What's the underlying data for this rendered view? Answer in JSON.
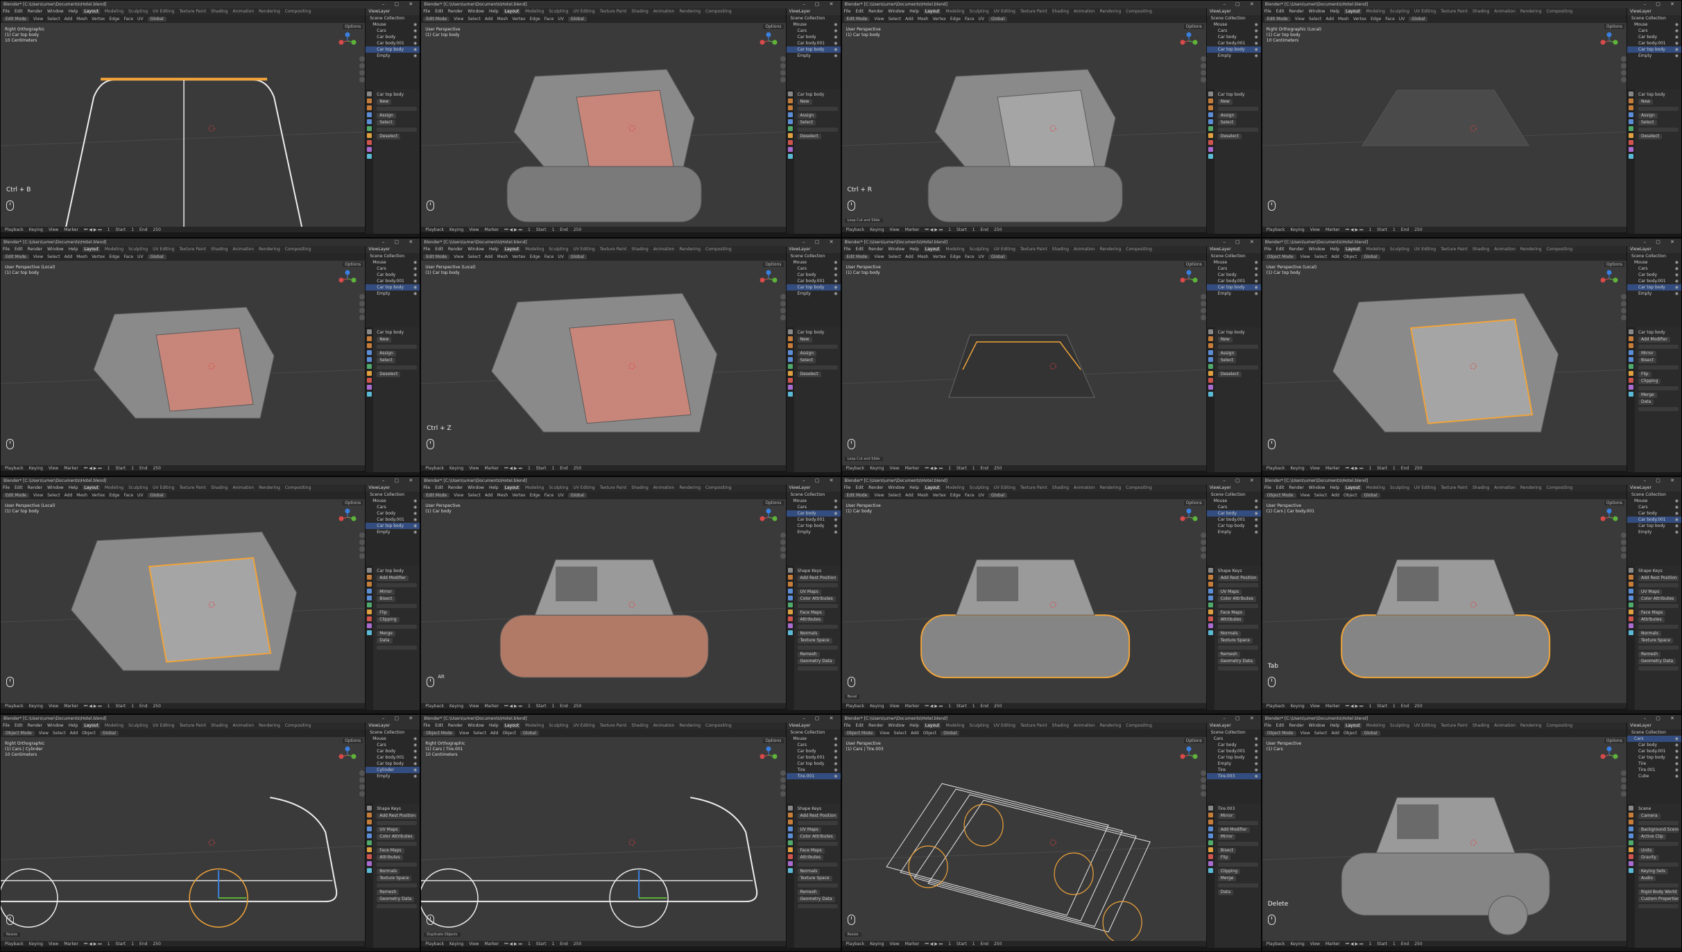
{
  "app": {
    "title": "Blender* [C:\\Users\\umer\\Documents\\Hotel.blend]",
    "menus": [
      "File",
      "Edit",
      "Render",
      "Window",
      "Help"
    ],
    "workspaces": [
      "Layout",
      "Modeling",
      "Sculpting",
      "UV Editing",
      "Texture Paint",
      "Shading",
      "Animation",
      "Rendering",
      "Compositing"
    ],
    "active_workspace": "Layout",
    "scene": "Scene",
    "view_layer": "ViewLayer",
    "header_menus": [
      "View",
      "Select",
      "Add",
      "Mesh",
      "Vertex",
      "Edge",
      "Face",
      "UV"
    ],
    "object_menus": [
      "View",
      "Select",
      "Add",
      "Object"
    ],
    "transform": "Global",
    "options": "Options",
    "timeline": [
      "Playback",
      "Keying",
      "View",
      "Marker"
    ],
    "frame": "1",
    "start_label": "Start",
    "start": "1",
    "end_label": "End",
    "end": "250",
    "outliner_title": "Scene Collection",
    "modifier_tab": "Car top body"
  },
  "colors": {
    "viewport_bg": "#3a3a3a",
    "selection": "#f0a43a",
    "active_row": "#334d80",
    "face_select": "#c8867a"
  },
  "tiles": [
    {
      "mode": "Edit Mode",
      "info": "Right Orthographic\n(1) Car top body\n10 Centimeters",
      "shortcut": "Ctrl + B",
      "outliner": [
        "Mouse",
        "Cars",
        "Car body",
        "Car body.001",
        "Car top body",
        "Empty"
      ],
      "selected": 4,
      "props": [
        "Car top body",
        "New",
        "Assign",
        "Select",
        "Deselect"
      ]
    },
    {
      "mode": "Edit Mode",
      "info": "User Perspective\n(1) Car top body",
      "shortcut": "",
      "outliner": [
        "Mouse",
        "Cars",
        "Car body",
        "Car body.001",
        "Car top body",
        "Empty"
      ],
      "selected": 4,
      "props": [
        "Car top body",
        "New",
        "Assign",
        "Select",
        "Deselect"
      ]
    },
    {
      "mode": "Edit Mode",
      "info": "User Perspective\n(1) Car top body",
      "shortcut": "Ctrl + R",
      "outliner": [
        "Mouse",
        "Cars",
        "Car body",
        "Car body.001",
        "Car top body",
        "Empty"
      ],
      "selected": 4,
      "props": [
        "Car top body",
        "New",
        "Assign",
        "Select",
        "Deselect"
      ],
      "operator": "Loop Cut and Slide"
    },
    {
      "mode": "Edit Mode",
      "info": "Right Orthographic (Local)\n(1) Car top body\n10 Centimeters",
      "shortcut": "",
      "outliner": [
        "Mouse",
        "Cars",
        "Car body",
        "Car body.001",
        "Car top body",
        "Empty"
      ],
      "selected": 4,
      "props": [
        "Car top body",
        "New",
        "Assign",
        "Select",
        "Deselect"
      ]
    },
    {
      "mode": "Edit Mode",
      "info": "User Perspective (Local)\n(1) Car top body",
      "shortcut": "",
      "outliner": [
        "Mouse",
        "Cars",
        "Car body",
        "Car body.001",
        "Car top body",
        "Empty"
      ],
      "selected": 4,
      "props": [
        "Car top body",
        "New",
        "Assign",
        "Select",
        "Deselect"
      ]
    },
    {
      "mode": "Edit Mode",
      "info": "User Perspective (Local)\n(1) Car top body",
      "shortcut": "Ctrl + Z",
      "outliner": [
        "Mouse",
        "Cars",
        "Car body",
        "Car body.001",
        "Car top body",
        "Empty"
      ],
      "selected": 4,
      "props": [
        "Car top body",
        "New",
        "Assign",
        "Select",
        "Deselect"
      ]
    },
    {
      "mode": "Edit Mode",
      "info": "User Perspective\n(1) Car top body",
      "shortcut": "",
      "outliner": [
        "Mouse",
        "Cars",
        "Car body",
        "Car body.001",
        "Car top body",
        "Empty"
      ],
      "selected": 4,
      "props": [
        "Car top body",
        "New",
        "Assign",
        "Select",
        "Deselect"
      ],
      "operator": "Loop Cut and Slide"
    },
    {
      "mode": "Object Mode",
      "info": "User Perspective (Local)\n(1) Car top body",
      "shortcut": "",
      "outliner": [
        "Mouse",
        "Cars",
        "Car body",
        "Car body.001",
        "Car top body",
        "Empty"
      ],
      "selected": 4,
      "props": [
        "Car top body",
        "Add Modifier",
        "Mirror",
        "Bisect",
        "Flip",
        "Clipping",
        "Merge",
        "Data"
      ]
    },
    {
      "mode": "Edit Mode",
      "info": "User Perspective (Local)\n(1) Car top body",
      "shortcut": "",
      "outliner": [
        "Mouse",
        "Cars",
        "Car body",
        "Car body.001",
        "Car top body",
        "Empty"
      ],
      "selected": 4,
      "props": [
        "Car top body",
        "Add Modifier",
        "Mirror",
        "Bisect",
        "Flip",
        "Clipping",
        "Merge",
        "Data"
      ]
    },
    {
      "mode": "Edit Mode",
      "info": "User Perspective\n(1) Car body",
      "shortcut": "",
      "outliner": [
        "Mouse",
        "Cars",
        "Car body",
        "Car body.001",
        "Car top body",
        "Empty"
      ],
      "selected": 2,
      "props": [
        "Shape Keys",
        "Add Rest Position",
        "UV Maps",
        "Color Attributes",
        "Face Maps",
        "Attributes",
        "Normals",
        "Texture Space",
        "Remesh",
        "Geometry Data"
      ],
      "shortcut_alt": "Alt"
    },
    {
      "mode": "Edit Mode",
      "info": "User Perspective\n(1) Car body",
      "shortcut": "",
      "outliner": [
        "Mouse",
        "Cars",
        "Car body",
        "Car body.001",
        "Car top body",
        "Empty"
      ],
      "selected": 2,
      "props": [
        "Shape Keys",
        "Add Rest Position",
        "UV Maps",
        "Color Attributes",
        "Face Maps",
        "Attributes",
        "Normals",
        "Texture Space",
        "Remesh",
        "Geometry Data"
      ],
      "operator": "Bevel"
    },
    {
      "mode": "Object Mode",
      "info": "User Perspective\n(1) Cars | Car body.001",
      "shortcut": "Tab",
      "outliner": [
        "Mouse",
        "Cars",
        "Car body",
        "Car body.001",
        "Car top body",
        "Empty"
      ],
      "selected": 3,
      "props": [
        "Shape Keys",
        "Add Rest Position",
        "UV Maps",
        "Color Attributes",
        "Face Maps",
        "Attributes",
        "Normals",
        "Texture Space",
        "Remesh",
        "Geometry Data"
      ]
    },
    {
      "mode": "Object Mode",
      "info": "Right Orthographic\n(1) Cars | Cylinder\n10 Centimeters",
      "shortcut": "",
      "outliner": [
        "Mouse",
        "Cars",
        "Car body",
        "Car body.001",
        "Car top body",
        "Cylinder",
        "Empty"
      ],
      "selected": 5,
      "props": [
        "Shape Keys",
        "Add Rest Position",
        "UV Maps",
        "Color Attributes",
        "Face Maps",
        "Attributes",
        "Normals",
        "Texture Space",
        "Remesh",
        "Geometry Data"
      ],
      "operator": "Resize"
    },
    {
      "mode": "Object Mode",
      "info": "Right Orthographic\n(1) Cars | Tire.001\n10 Centimeters",
      "shortcut": "",
      "outliner": [
        "Mouse",
        "Cars",
        "Car body",
        "Car body.001",
        "Car top body",
        "Tire",
        "Tire.001"
      ],
      "selected": 6,
      "props": [
        "Shape Keys",
        "Add Rest Position",
        "UV Maps",
        "Color Attributes",
        "Face Maps",
        "Attributes",
        "Normals",
        "Texture Space",
        "Remesh",
        "Geometry Data"
      ],
      "operator": "Duplicate Objects"
    },
    {
      "mode": "Object Mode",
      "info": "User Perspective\n(1) Cars | Tire.003",
      "shortcut": "",
      "outliner": [
        "Cars",
        "Car body",
        "Car body.001",
        "Car top body",
        "Empty",
        "Tire",
        "Tire.003"
      ],
      "selected": 6,
      "props": [
        "Tire.003",
        "Mirror",
        "Add Modifier",
        "Mirror",
        "Bisect",
        "Flip",
        "Clipping",
        "Merge",
        "Data"
      ],
      "operator": "Resize"
    },
    {
      "mode": "Object Mode",
      "info": "User Perspective\n(1) Cars",
      "shortcut": "Delete",
      "outliner": [
        "Cars",
        "Car body",
        "Car body.001",
        "Car top body",
        "Tire",
        "Tire.001",
        "Cube"
      ],
      "selected": 0,
      "props": [
        "Scene",
        "Camera",
        "Background Scene",
        "Active Clip",
        "Units",
        "Gravity",
        "Keying Sets",
        "Audio",
        "Rigid Body World",
        "Custom Properties"
      ]
    }
  ]
}
